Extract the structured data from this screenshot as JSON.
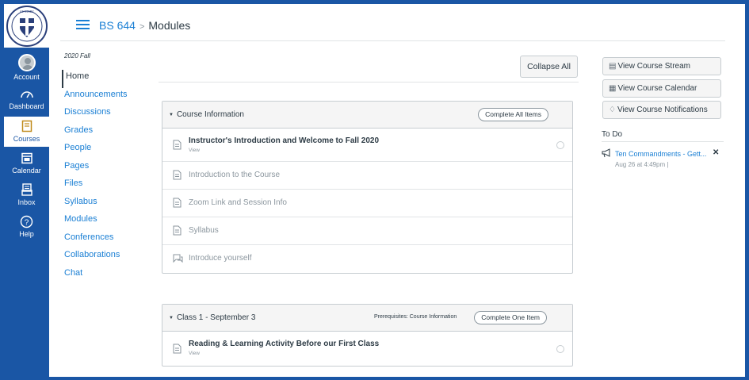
{
  "header": {
    "course": "BS 644",
    "separator": ">",
    "page": "Modules"
  },
  "global_nav": {
    "account": "Account",
    "dashboard": "Dashboard",
    "courses": "Courses",
    "calendar": "Calendar",
    "inbox": "Inbox",
    "help": "Help"
  },
  "course_nav": {
    "term": "2020 Fall",
    "items": [
      "Home",
      "Announcements",
      "Discussions",
      "Grades",
      "People",
      "Pages",
      "Files",
      "Syllabus",
      "Modules",
      "Conferences",
      "Collaborations",
      "Chat"
    ]
  },
  "content": {
    "collapse_all": "Collapse All",
    "modules": [
      {
        "title": "Course Information",
        "requirement": "Complete All Items",
        "items": [
          {
            "title": "Instructor's Introduction and Welcome to Fall 2020",
            "sub": "View",
            "icon": "page-icon"
          },
          {
            "title": "Introduction to the Course",
            "icon": "page-icon"
          },
          {
            "title": "Zoom Link and Session Info",
            "icon": "page-icon"
          },
          {
            "title": "Syllabus",
            "icon": "page-icon"
          },
          {
            "title": "Introduce yourself",
            "icon": "discussion-icon"
          }
        ]
      },
      {
        "title": "Class 1 - September 3",
        "prerequisites": "Prerequisites: Course Information",
        "requirement": "Complete One Item",
        "items": [
          {
            "title": "Reading & Learning Activity Before our First Class",
            "sub": "View",
            "icon": "page-icon"
          }
        ]
      }
    ]
  },
  "sidebar": {
    "stream": "View Course Stream",
    "calendar": "View Course Calendar",
    "notifications": "View Course Notifications",
    "todo_title": "To Do",
    "todo_item": "Ten Commandments - Gett...",
    "todo_date": "Aug 26 at 4:49pm  |"
  },
  "colors": {
    "brand": "#1a56a5",
    "link": "#1a7fd4"
  }
}
